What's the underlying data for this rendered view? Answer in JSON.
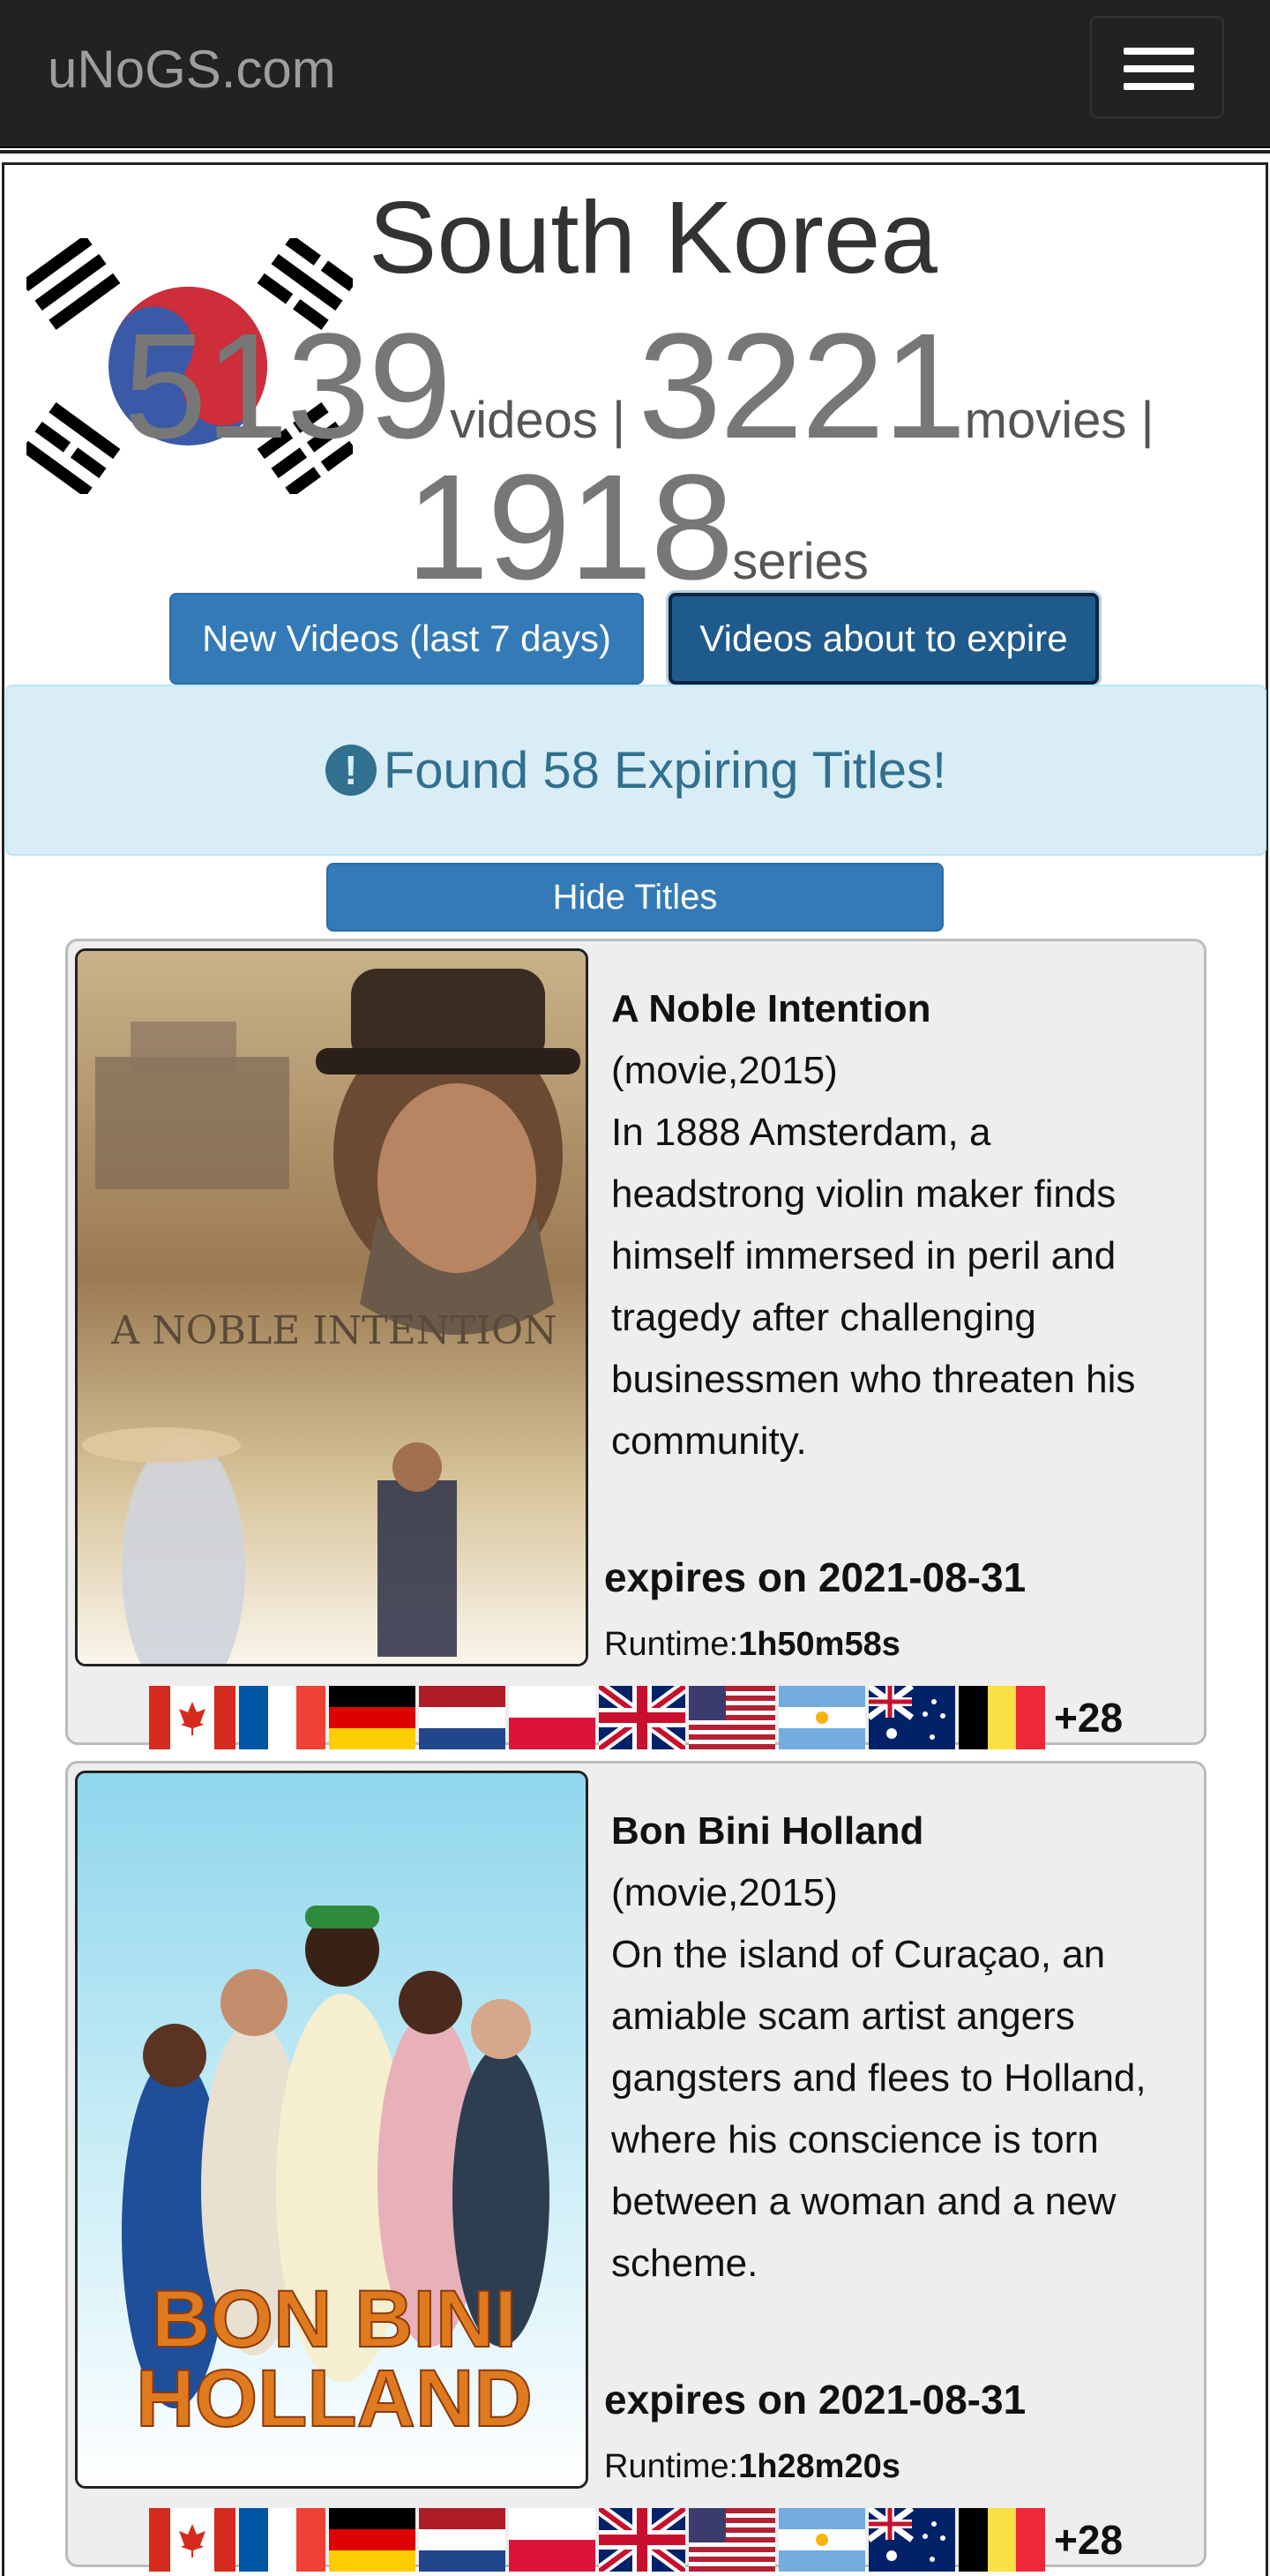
{
  "navbar": {
    "brand": "uNoGS.com"
  },
  "header": {
    "country": "South Korea",
    "videos_count": "5139",
    "videos_label": "videos |",
    "movies_count": "3221",
    "movies_label": "movies |",
    "series_count": "1918",
    "series_label": "series"
  },
  "buttons": {
    "new_videos": "New Videos (last 7 days)",
    "expiring": "Videos about to expire",
    "hide_titles": "Hide Titles"
  },
  "alert": {
    "text": "Found 58 Expiring Titles!"
  },
  "titles": [
    {
      "title": "A Noble Intention",
      "meta": "(movie,2015)",
      "synopsis": "In 1888 Amsterdam, a headstrong violin maker finds himself immersed in peril and tragedy after challenging businessmen who threaten his community.",
      "expires": "expires on 2021-08-31",
      "runtime_label": "Runtime:",
      "runtime": "1h50m58s",
      "poster_text": "A NOBLE INTENTION",
      "more_countries": "+28"
    },
    {
      "title": "Bon Bini Holland",
      "meta": "(movie,2015)",
      "synopsis": "On the island of Curaçao, an amiable scam artist angers gangsters and flees to Holland, where his conscience is torn between a woman and a new scheme.",
      "expires": "expires on 2021-08-31",
      "runtime_label": "Runtime:",
      "runtime": "1h28m20s",
      "poster_text_1": "BON BINI",
      "poster_text_2": "HOLLAND",
      "more_countries": "+28"
    }
  ],
  "flags": [
    "canada-flag",
    "france-flag",
    "germany-flag",
    "netherlands-flag",
    "poland-flag",
    "uk-flag",
    "usa-flag",
    "argentina-flag",
    "australia-flag",
    "belgium-flag"
  ],
  "colors": {
    "navbar": "#222222",
    "primary": "#337ab7",
    "alert_bg": "#d9edf7",
    "alert_text": "#31708f"
  }
}
